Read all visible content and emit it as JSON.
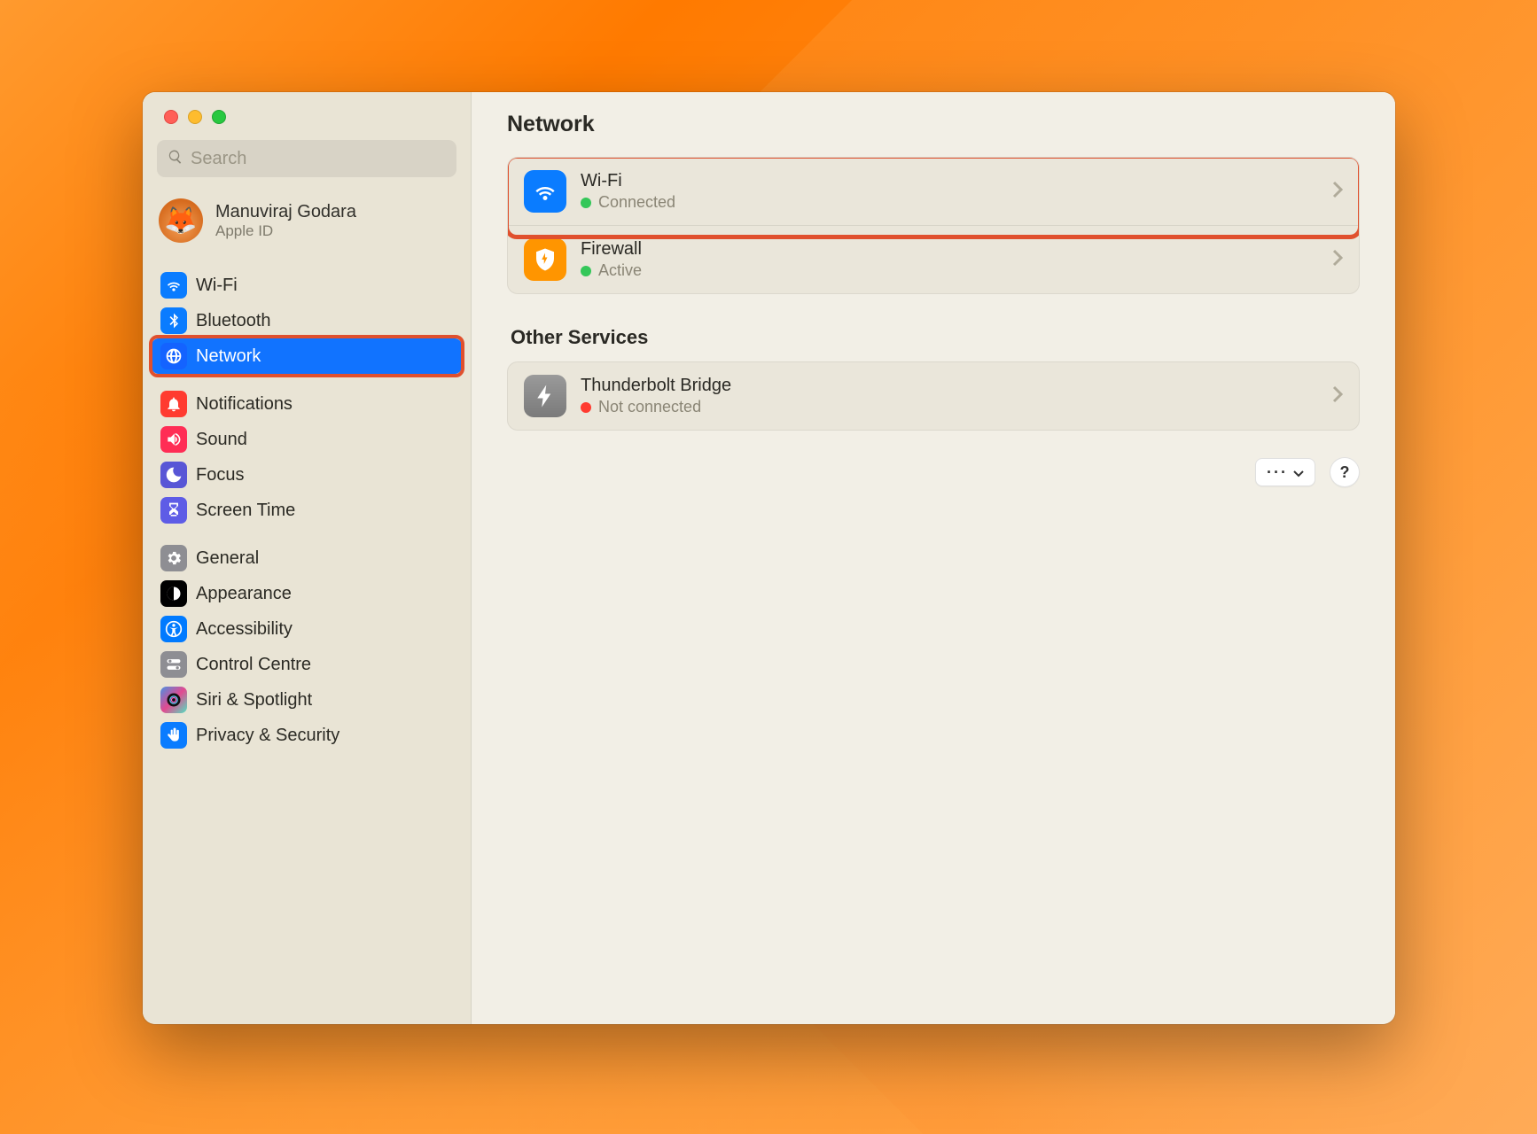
{
  "search": {
    "placeholder": "Search"
  },
  "account": {
    "name": "Manuviraj Godara",
    "sub": "Apple ID",
    "avatar_emoji": "🦊"
  },
  "sidebar": {
    "groups": [
      {
        "items": [
          {
            "id": "wifi",
            "label": "Wi-Fi",
            "icon": "wifi",
            "bg": "bg-blue",
            "selected": false
          },
          {
            "id": "bluetooth",
            "label": "Bluetooth",
            "icon": "bluetooth",
            "bg": "bg-blue",
            "selected": false
          },
          {
            "id": "network",
            "label": "Network",
            "icon": "globe",
            "bg": "bg-blue2",
            "selected": true,
            "highlight": true
          }
        ]
      },
      {
        "items": [
          {
            "id": "notifications",
            "label": "Notifications",
            "icon": "bell",
            "bg": "bg-red"
          },
          {
            "id": "sound",
            "label": "Sound",
            "icon": "speaker",
            "bg": "bg-pink"
          },
          {
            "id": "focus",
            "label": "Focus",
            "icon": "moon",
            "bg": "bg-purple"
          },
          {
            "id": "screentime",
            "label": "Screen Time",
            "icon": "hourglass",
            "bg": "bg-indigo"
          }
        ]
      },
      {
        "items": [
          {
            "id": "general",
            "label": "General",
            "icon": "gear",
            "bg": "bg-gray"
          },
          {
            "id": "appearance",
            "label": "Appearance",
            "icon": "appearance",
            "bg": "bg-black"
          },
          {
            "id": "accessibility",
            "label": "Accessibility",
            "icon": "accessibility",
            "bg": "bg-teal"
          },
          {
            "id": "controlcentre",
            "label": "Control Centre",
            "icon": "switches",
            "bg": "bg-gray"
          },
          {
            "id": "siri",
            "label": "Siri & Spotlight",
            "icon": "siri",
            "bg": "bg-siri"
          },
          {
            "id": "privacy",
            "label": "Privacy & Security",
            "icon": "hand",
            "bg": "bg-hand"
          }
        ]
      }
    ]
  },
  "main": {
    "title": "Network",
    "primary": [
      {
        "id": "wifi",
        "title": "Wi-Fi",
        "status_text": "Connected",
        "status": "green",
        "icon": "wifi",
        "bg": "bg-blue",
        "highlight": true
      },
      {
        "id": "firewall",
        "title": "Firewall",
        "status_text": "Active",
        "status": "green",
        "icon": "firewall",
        "bg": "bg-orange"
      }
    ],
    "other_title": "Other Services",
    "other": [
      {
        "id": "tbbridge",
        "title": "Thunderbolt Bridge",
        "status_text": "Not connected",
        "status": "red",
        "icon": "bolt",
        "bg": "ico-gray"
      }
    ],
    "more_button": "···",
    "help_button": "?"
  }
}
